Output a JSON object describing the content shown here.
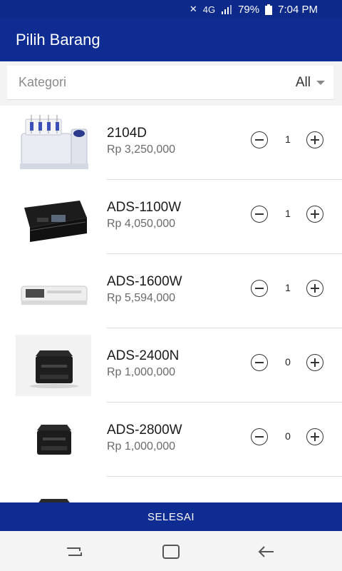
{
  "status_bar": {
    "battery": "79%",
    "time": "7:04 PM",
    "network": "4G"
  },
  "app_bar": {
    "title": "Pilih Barang"
  },
  "filter": {
    "label": "Kategori",
    "selected": "All"
  },
  "products": [
    {
      "name": "2104D",
      "price": "Rp 3,250,000",
      "qty": "1",
      "image": "overlock-sewing-machine"
    },
    {
      "name": "ADS-1100W",
      "price": "Rp 4,050,000",
      "qty": "1",
      "image": "black-compact-scanner"
    },
    {
      "name": "ADS-1600W",
      "price": "Rp 5,594,000",
      "qty": "1",
      "image": "white-compact-scanner"
    },
    {
      "name": "ADS-2400N",
      "price": "Rp 1,000,000",
      "qty": "0",
      "image": "desktop-scanner"
    },
    {
      "name": "ADS-2800W",
      "price": "Rp 1,000,000",
      "qty": "0",
      "image": "desktop-scanner"
    }
  ],
  "footer": {
    "finish_label": "SELESAI"
  },
  "colors": {
    "primary": "#0f2c92",
    "status_bar": "#0d2a8a"
  }
}
